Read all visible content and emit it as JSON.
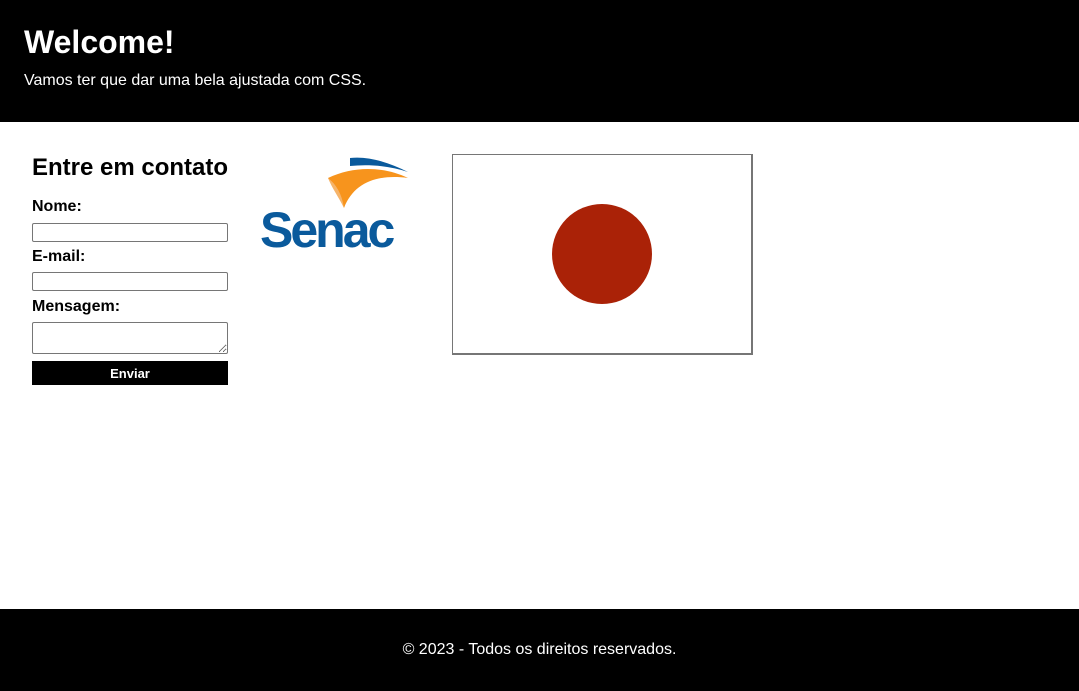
{
  "header": {
    "title": "Welcome!",
    "subtitle": "Vamos ter que dar uma bela ajustada com CSS."
  },
  "contact": {
    "title": "Entre em contato",
    "name_label": "Nome:",
    "name_value": "",
    "email_label": "E-mail:",
    "email_value": "",
    "message_label": "Mensagem:",
    "message_value": "",
    "submit_label": "Enviar"
  },
  "logo": {
    "text": "Senac",
    "text_color": "#0a5a9c",
    "swoosh_orange": "#f7941d",
    "swoosh_blue": "#0a5a9c"
  },
  "flag": {
    "background": "#ffffff",
    "disc_color": "#aa2207"
  },
  "footer": {
    "text": "© 2023 - Todos os direitos reservados."
  },
  "colors": {
    "header_bg": "#000000",
    "footer_bg": "#000000",
    "button_bg": "#000000"
  }
}
